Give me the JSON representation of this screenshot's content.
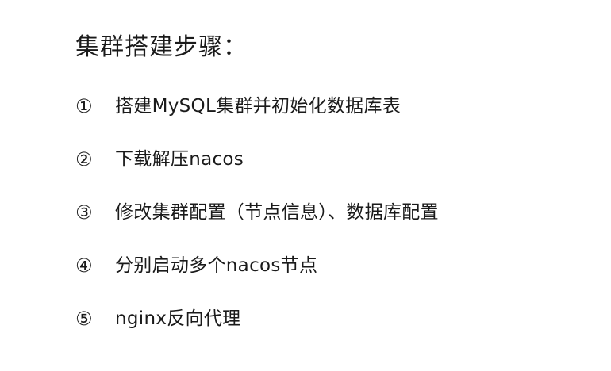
{
  "title": "集群搭建步骤：",
  "steps": [
    {
      "num": "①",
      "text": "搭建MySQL集群并初始化数据库表"
    },
    {
      "num": "②",
      "text": "下载解压nacos"
    },
    {
      "num": "③",
      "text": "修改集群配置（节点信息）、数据库配置"
    },
    {
      "num": "④",
      "text": "分别启动多个nacos节点"
    },
    {
      "num": "⑤",
      "text": "nginx反向代理"
    }
  ]
}
